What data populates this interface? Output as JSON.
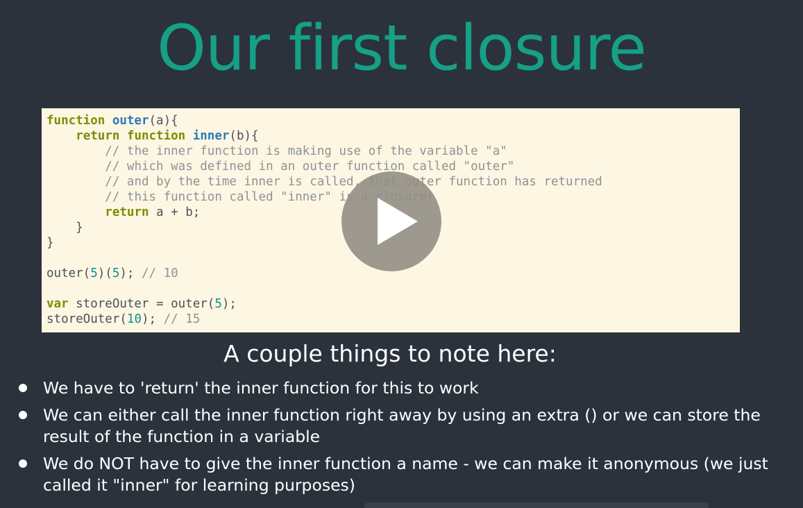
{
  "slide": {
    "title": "Our first closure",
    "subtitle": "A couple things to note here:"
  },
  "code": {
    "lines": [
      [
        {
          "t": "kw",
          "v": "function "
        },
        {
          "t": "fn",
          "v": "outer"
        },
        {
          "t": "plain",
          "v": "(a){"
        }
      ],
      [
        {
          "t": "plain",
          "v": "    "
        },
        {
          "t": "kw",
          "v": "return function "
        },
        {
          "t": "fn",
          "v": "inner"
        },
        {
          "t": "plain",
          "v": "(b){"
        }
      ],
      [
        {
          "t": "plain",
          "v": "        "
        },
        {
          "t": "cm",
          "v": "// the inner function is making use of the variable \"a\""
        }
      ],
      [
        {
          "t": "plain",
          "v": "        "
        },
        {
          "t": "cm",
          "v": "// which was defined in an outer function called \"outer\""
        }
      ],
      [
        {
          "t": "plain",
          "v": "        "
        },
        {
          "t": "cm",
          "v": "// and by the time inner is called, that outer function has returned"
        }
      ],
      [
        {
          "t": "plain",
          "v": "        "
        },
        {
          "t": "cm",
          "v": "// this function called \"inner\" is a closure!"
        }
      ],
      [
        {
          "t": "plain",
          "v": "        "
        },
        {
          "t": "kw",
          "v": "return"
        },
        {
          "t": "plain",
          "v": " a + b;"
        }
      ],
      [
        {
          "t": "plain",
          "v": "    }"
        }
      ],
      [
        {
          "t": "plain",
          "v": "}"
        }
      ],
      [
        {
          "t": "plain",
          "v": ""
        }
      ],
      [
        {
          "t": "plain",
          "v": "outer("
        },
        {
          "t": "num",
          "v": "5"
        },
        {
          "t": "plain",
          "v": ")("
        },
        {
          "t": "num",
          "v": "5"
        },
        {
          "t": "plain",
          "v": "); "
        },
        {
          "t": "cm",
          "v": "// 10"
        }
      ],
      [
        {
          "t": "plain",
          "v": ""
        }
      ],
      [
        {
          "t": "kw",
          "v": "var"
        },
        {
          "t": "plain",
          "v": " storeOuter = outer("
        },
        {
          "t": "num",
          "v": "5"
        },
        {
          "t": "plain",
          "v": ");"
        }
      ],
      [
        {
          "t": "plain",
          "v": "storeOuter("
        },
        {
          "t": "num",
          "v": "10"
        },
        {
          "t": "plain",
          "v": "); "
        },
        {
          "t": "cm",
          "v": "// 15"
        }
      ]
    ]
  },
  "bullets": [
    "We have to 'return' the inner function for this to work",
    "We can either call the inner function right away by using an extra () or we can store the result of the function in a variable",
    "We do NOT have to give the inner function a name - we can make it anonymous (we just called it \"inner\" for learning purposes)"
  ],
  "video": {
    "play_icon": "play-icon"
  },
  "colors": {
    "background": "#2b323c",
    "title": "#16a085",
    "code_background": "#fdf6e3",
    "keyword": "#7f8c00",
    "function_name": "#2c7ab8",
    "comment": "#8c9396",
    "number": "#0f8f8f"
  }
}
